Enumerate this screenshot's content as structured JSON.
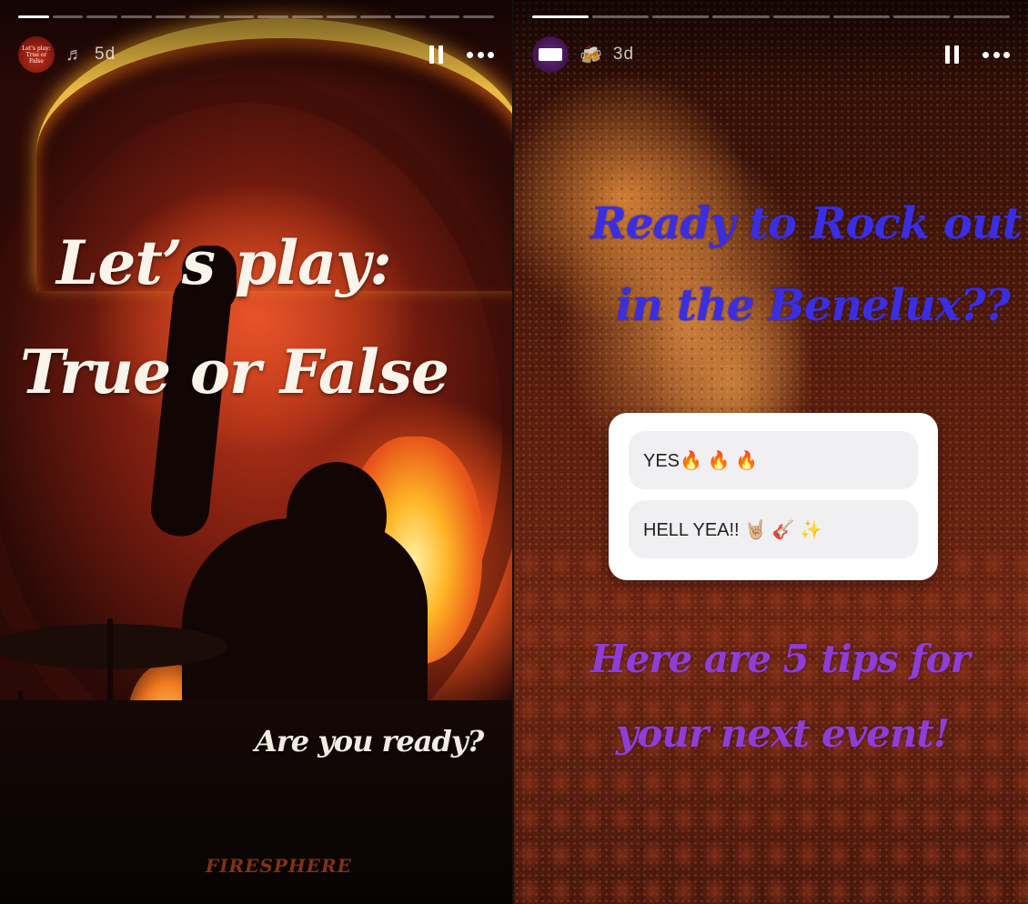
{
  "stories": [
    {
      "posted_ago": "5d",
      "sticker_icon": "music-notes-icon",
      "avatar_text": "Let's play: True or False",
      "progress_segments": 14,
      "active_segment": 1,
      "title_line1": "Let’s play:",
      "title_line2": "True or False",
      "subtitle": "Are you ready?",
      "watermark": "FIRESPHERE"
    },
    {
      "posted_ago": "3d",
      "sticker_icon": "beer-mugs-icon",
      "progress_segments": 8,
      "active_segment": 1,
      "title_line1": "Ready to Rock out",
      "title_line2": "in the Benelux??",
      "poll": {
        "option1": "YES🔥 🔥 🔥",
        "option2": "HELL YEA!! 🤘🏼 🎸 ✨"
      },
      "footer_line1": "Here are 5 tips for",
      "footer_line2": "your next event!"
    }
  ],
  "colors": {
    "title_blue": "#3a2ee0",
    "footer_purple": "#8e3ed6",
    "story1_text": "#fbf4ea"
  }
}
